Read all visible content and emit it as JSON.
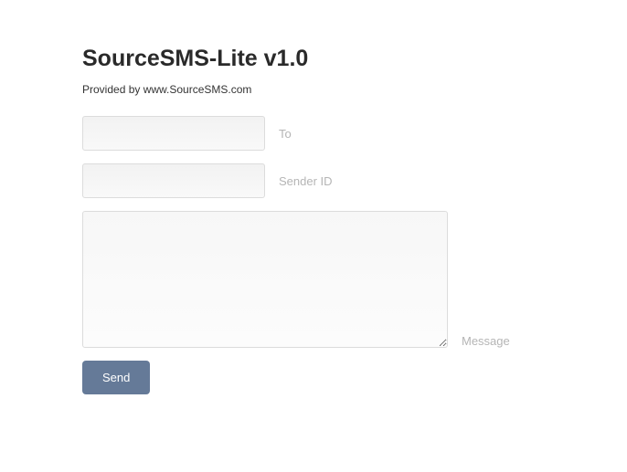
{
  "header": {
    "title": "SourceSMS-Lite v1.0",
    "subtitle": "Provided by www.SourceSMS.com"
  },
  "form": {
    "to": {
      "value": "",
      "label": "To"
    },
    "sender_id": {
      "value": "",
      "label": "Sender ID"
    },
    "message": {
      "value": "",
      "label": "Message"
    },
    "send_label": "Send"
  }
}
